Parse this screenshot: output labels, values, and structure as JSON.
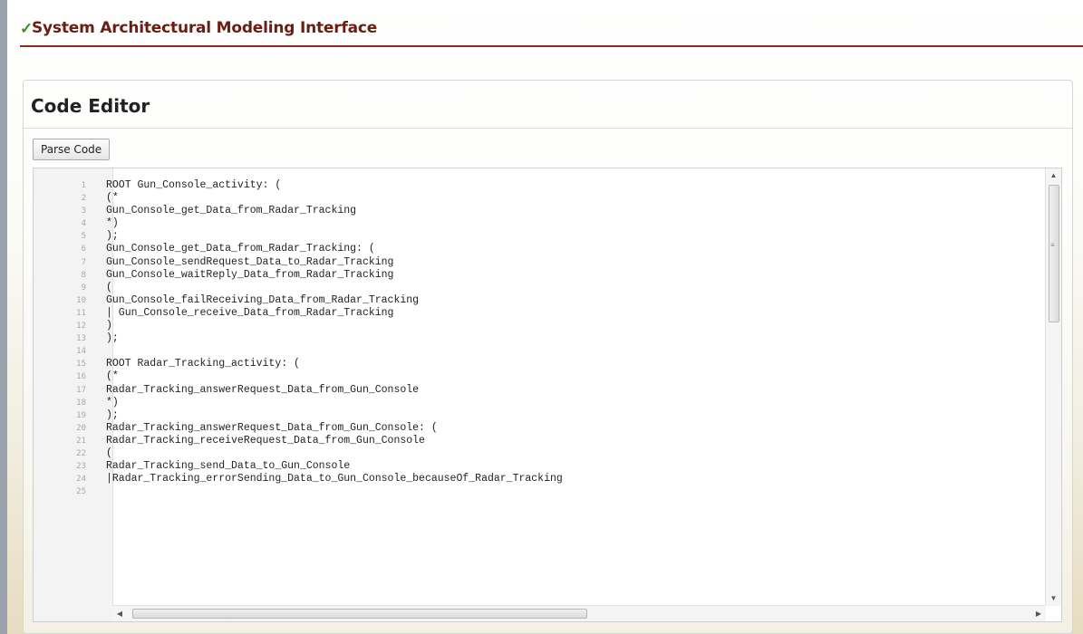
{
  "app": {
    "title": "System Architectural Modeling Interface",
    "check_icon": "checkmark-icon",
    "brand_color": "#6b1d12"
  },
  "panel": {
    "title": "Code Editor",
    "parse_label": "Parse Code"
  },
  "editor": {
    "line_numbers": [
      "1",
      "2",
      "3",
      "4",
      "5",
      "6",
      "7",
      "8",
      "9",
      "10",
      "11",
      "12",
      "13",
      "14",
      "15",
      "16",
      "17",
      "18",
      "19",
      "20",
      "21",
      "22",
      "23",
      "24",
      "25"
    ],
    "lines": [
      "ROOT Gun_Console_activity: (",
      "(*",
      "Gun_Console_get_Data_from_Radar_Tracking",
      "*)",
      ");",
      "Gun_Console_get_Data_from_Radar_Tracking: (",
      "Gun_Console_sendRequest_Data_to_Radar_Tracking",
      "Gun_Console_waitReply_Data_from_Radar_Tracking",
      "(",
      "Gun_Console_failReceiving_Data_from_Radar_Tracking",
      "| Gun_Console_receive_Data_from_Radar_Tracking",
      ")",
      ");",
      "",
      "ROOT Radar_Tracking_activity: (",
      "(*",
      "Radar_Tracking_answerRequest_Data_from_Gun_Console",
      "*)",
      ");",
      "Radar_Tracking_answerRequest_Data_from_Gun_Console: (",
      "Radar_Tracking_receiveRequest_Data_from_Gun_Console",
      "(",
      "Radar_Tracking_send_Data_to_Gun_Console",
      "|Radar_Tracking_errorSending_Data_to_Gun_Console_becauseOf_Radar_Tracking",
      ""
    ]
  }
}
